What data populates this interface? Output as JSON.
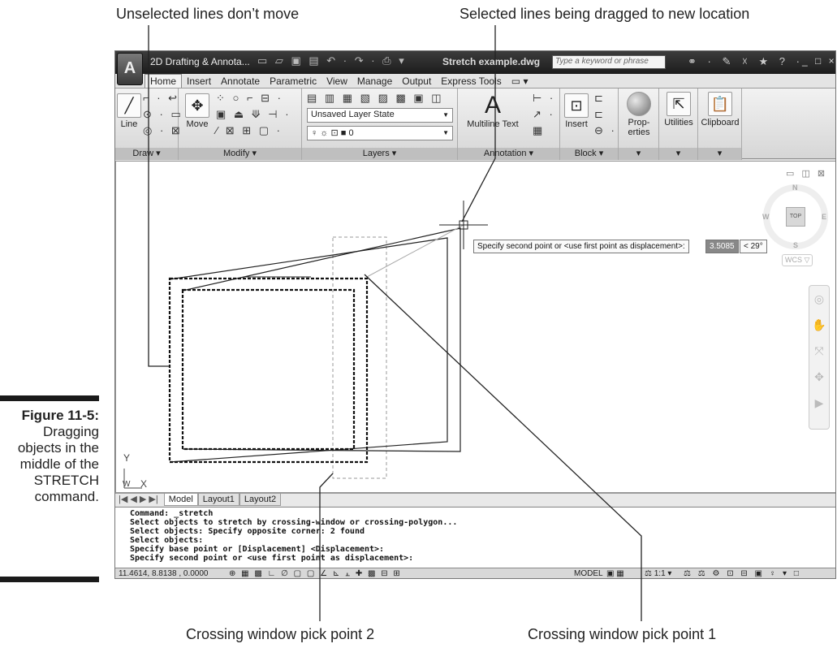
{
  "callouts": {
    "top_left": "Unselected lines don’t move",
    "top_right": "Selected lines being dragged to new location",
    "bottom_left": "Crossing window pick point 2",
    "bottom_right": "Crossing window pick point 1"
  },
  "figure": {
    "label": "Figure 11-5:",
    "caption": "Dragging objects in the middle of the STRETCH command."
  },
  "titlebar": {
    "app_icon": "A",
    "workspace": "2D Drafting & Annota...",
    "quick_access_icons": "▭ ▱ ▣ ▤ ↶ · ↷ · ⎙ ▾",
    "document": "Stretch example.dwg",
    "search_placeholder": "Type a keyword or phrase",
    "right_icons": "⚭ · ✎ ☓ ★ ? ·",
    "window_buttons": "_ □ ×"
  },
  "tabs": [
    "Home",
    "Insert",
    "Annotate",
    "Parametric",
    "View",
    "Manage",
    "Output",
    "Express Tools",
    "▭ ▾"
  ],
  "ribbon": {
    "draw": {
      "title": "Draw ▾",
      "line": "Line",
      "small_icons": [
        "⌐ ·  ↩",
        "⊙ ·  ▭",
        "◎ ·  ⊠"
      ]
    },
    "modify": {
      "title": "Modify ▾",
      "move": "Move",
      "small_icons": [
        "⁘ ○ ⌐ ⊟ ·",
        "▣ ⏏ ⟱ ⊣ ·",
        "⁄ ⊠ ⊞ ▢ ·"
      ]
    },
    "layers": {
      "title": "Layers ▾",
      "icons": "▤ ▥ ▦ ▧ ▨ ▩ ▣ ◫",
      "layer_state": "Unsaved Layer State",
      "layer_current": "0",
      "layer_icons": "♀ ☼ ⊡ ■"
    },
    "annotation": {
      "title": "Annotation ▾",
      "text": "Multiline Text",
      "icon": "A",
      "small_icons": [
        "⊢ ·",
        "↗ ·",
        "▦"
      ]
    },
    "block": {
      "title": "Block ▾",
      "insert": "Insert",
      "small_icons": [
        "⊏",
        "⊏",
        "⊖ ·"
      ]
    },
    "properties": {
      "label": "Prop-erties",
      "title": "▾"
    },
    "utilities": {
      "label": "Utilities",
      "title": "▾"
    },
    "clipboard": {
      "label": "Clipboard",
      "title": "▾"
    }
  },
  "viewport": {
    "controls": "▭ ◫ ⊠",
    "viewcube": {
      "top": "TOP",
      "n": "N",
      "s": "S",
      "e": "E",
      "w": "W",
      "wcs": "WCS ▽"
    },
    "ucs": {
      "y": "Y",
      "x": "X",
      "w": "W"
    },
    "tooltip": "Specify second point or <use first point as displacement>:",
    "distance": "3.5085",
    "angle": "< 29°",
    "navbar_icons": [
      "◎",
      "✋",
      "⤧",
      "✥",
      "▶"
    ]
  },
  "layout_tabs": [
    "Model",
    "Layout1",
    "Layout2"
  ],
  "layout_nav": "|◀ ◀ ▶ ▶|",
  "command_history": [
    "Command: _stretch",
    "Select objects to stretch by crossing-window or crossing-polygon...",
    "Select objects: Specify opposite corner: 2 found",
    "Select objects:",
    "Specify base point or [Displacement] <Displacement>:",
    "",
    "Specify second point or <use first point as displacement>:"
  ],
  "statusbar": {
    "coords": "11.4614, 8.8138 , 0.0000",
    "drafting_icons": "⊕ ▦ ▩ ∟ ∅ ▢ ▢ ∠ ⊾ ⫠ ✚ ▩ ⊟ ⊞",
    "model": "MODEL",
    "model_icons": "▣ ▦",
    "scale": "⚖ 1:1 ▾",
    "right_icons": "⚖ ⚖ ⚙ ⊡ ⊟ ▣ ♀ ▾ □"
  },
  "colors": {
    "selection_dash": "#111111",
    "crossing_window": "#999999",
    "rubber_band": "#aaaaaa"
  }
}
